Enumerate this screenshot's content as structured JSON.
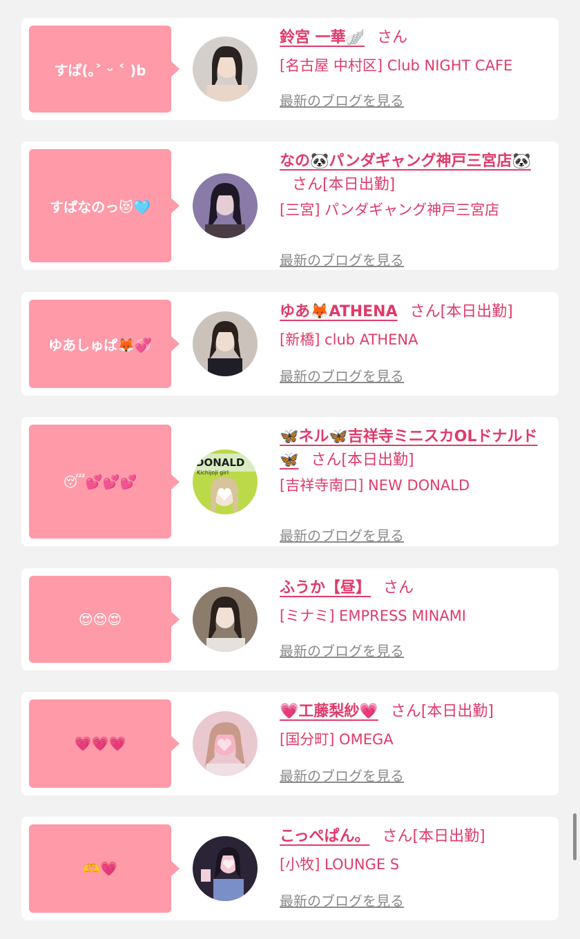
{
  "cards": [
    {
      "bubble": "すぱ(｡˃ ᵕ ˂ )b",
      "name": "鈴宮 一華🪽",
      "san": "さん",
      "status": "",
      "shop": "[名古屋 中村区] Club NIGHT CAFE",
      "blog": "最新のブログを見る",
      "avatar_bg": "#c8c2be"
    },
    {
      "bubble": "すぱなのっ😻🩵",
      "name": "なの🐼パンダギャング神戸三宮店🐼",
      "san": "さん",
      "status": "[本日出勤]",
      "shop": "[三宮] パンダギャング神戸三宮店",
      "blog": "最新のブログを見る",
      "avatar_bg": "#6c5a7e"
    },
    {
      "bubble": "ゆあしゅぱ🦊💞",
      "name": "ゆあ🦊ATHENA",
      "san": "さん",
      "status": "[本日出勤]",
      "shop": "[新橋] club ATHENA",
      "blog": "最新のブログを見る",
      "avatar_bg": "#bfb4ab"
    },
    {
      "bubble": "😴💕💕💕",
      "name": "🦋ネル🦋吉祥寺ミニスカOLドナルド🦋",
      "san": "さん",
      "status": "[本日出勤]",
      "shop": "[吉祥寺南口] NEW DONALD",
      "blog": "最新のブログを見る",
      "avatar_bg": "#b8d84a"
    },
    {
      "bubble": "😍😍😍",
      "name": "ふうか【昼】",
      "san": "さん",
      "status": "",
      "shop": "[ミナミ] EMPRESS MINAMI",
      "blog": "最新のブログを見る",
      "avatar_bg": "#7b6a5c"
    },
    {
      "bubble": "💗💗💗",
      "name": "💗工藤梨紗💗",
      "san": "さん",
      "status": "[本日出勤]",
      "shop": "[国分町] OMEGA",
      "blog": "最新のブログを見る",
      "avatar_bg": "#e8b4c2"
    },
    {
      "bubble": "🫶💗",
      "name": "こっぺぱん。",
      "san": "さん",
      "status": "[本日出勤]",
      "shop": "[小牧] LOUNGE S",
      "blog": "最新のブログを見る",
      "avatar_bg": "#2e2a3e"
    }
  ],
  "avatar_label_4": "DONALD",
  "avatar_sub_4": "Kichijoji girl"
}
